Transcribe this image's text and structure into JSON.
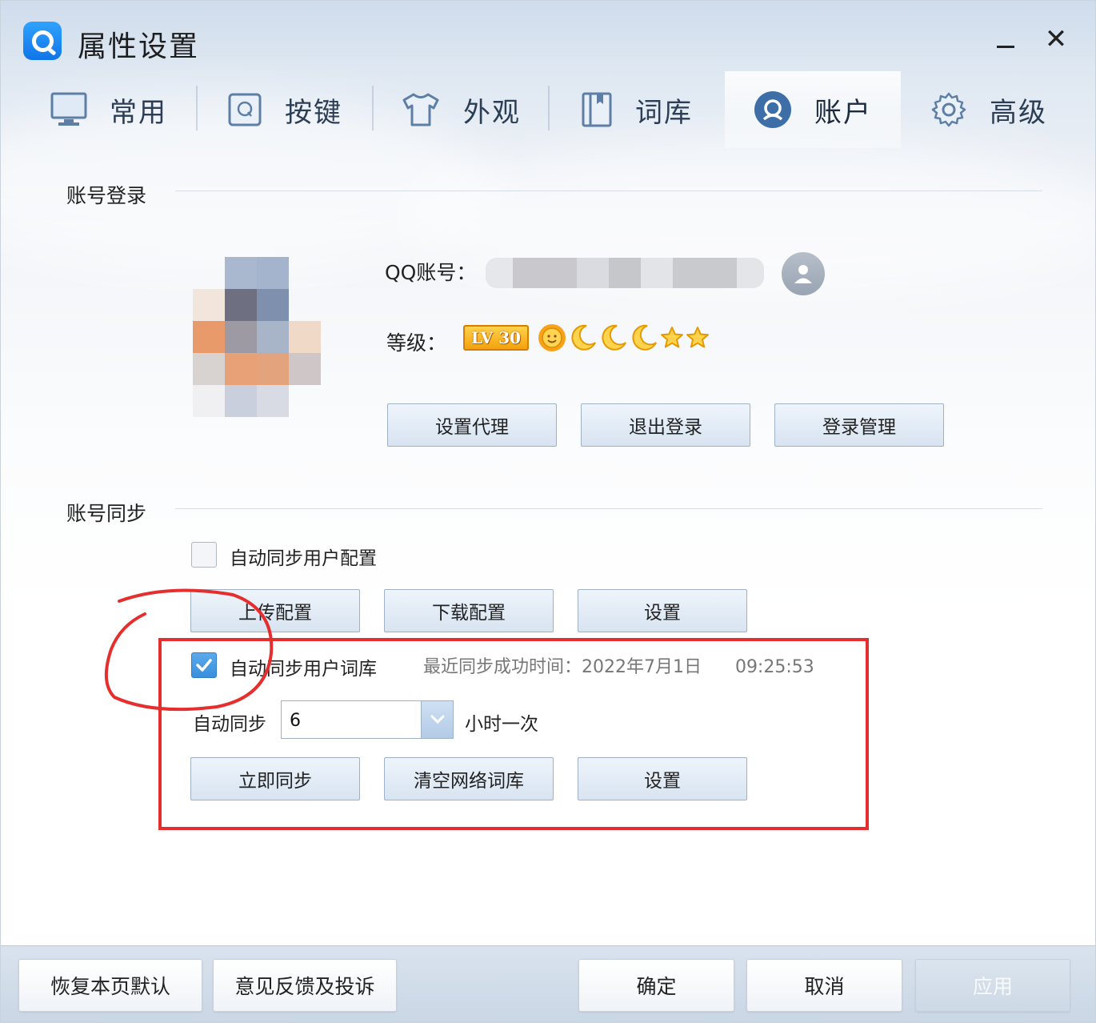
{
  "window": {
    "title": "属性设置",
    "minimize_label": "–",
    "close_label": "✕"
  },
  "tabs": [
    {
      "label": "常用",
      "icon": "monitor-icon",
      "active": false
    },
    {
      "label": "按键",
      "icon": "keyboard-key-icon",
      "active": false
    },
    {
      "label": "外观",
      "icon": "tshirt-icon",
      "active": false
    },
    {
      "label": "词库",
      "icon": "book-icon",
      "active": false
    },
    {
      "label": "账户",
      "icon": "account-icon",
      "active": true
    },
    {
      "label": "高级",
      "icon": "gear-icon",
      "active": false
    }
  ],
  "account_login": {
    "section_title": "账号登录",
    "qq_label": "QQ账号：",
    "level_label": "等级：",
    "level_badge": "LV 30",
    "level_icons": [
      "sun-icon",
      "moon-icon",
      "moon-icon",
      "moon-icon",
      "star-icon",
      "star-icon"
    ],
    "buttons": {
      "proxy": "设置代理",
      "logout": "退出登录",
      "manage": "登录管理"
    }
  },
  "account_sync": {
    "section_title": "账号同步",
    "auto_sync_config": {
      "label": "自动同步用户配置",
      "checked": false
    },
    "config_buttons": {
      "upload": "上传配置",
      "download": "下载配置",
      "settings": "设置"
    },
    "auto_sync_dict": {
      "label": "自动同步用户词库",
      "checked": true
    },
    "last_sync": "最近同步成功时间：2022年7月1日      09:25:53",
    "interval_prefix": "自动同步",
    "interval_value": "6",
    "interval_suffix": "小时一次",
    "dict_buttons": {
      "sync_now": "立即同步",
      "clear": "清空网络词库",
      "settings": "设置"
    }
  },
  "footer": {
    "restore": "恢复本页默认",
    "feedback": "意见反馈及投诉",
    "ok": "确定",
    "cancel": "取消",
    "apply": "应用"
  },
  "colors": {
    "accent_blue": "#1a82f0",
    "annotation_red": "#e52e2e",
    "lv_badge": "#f5a70f"
  }
}
